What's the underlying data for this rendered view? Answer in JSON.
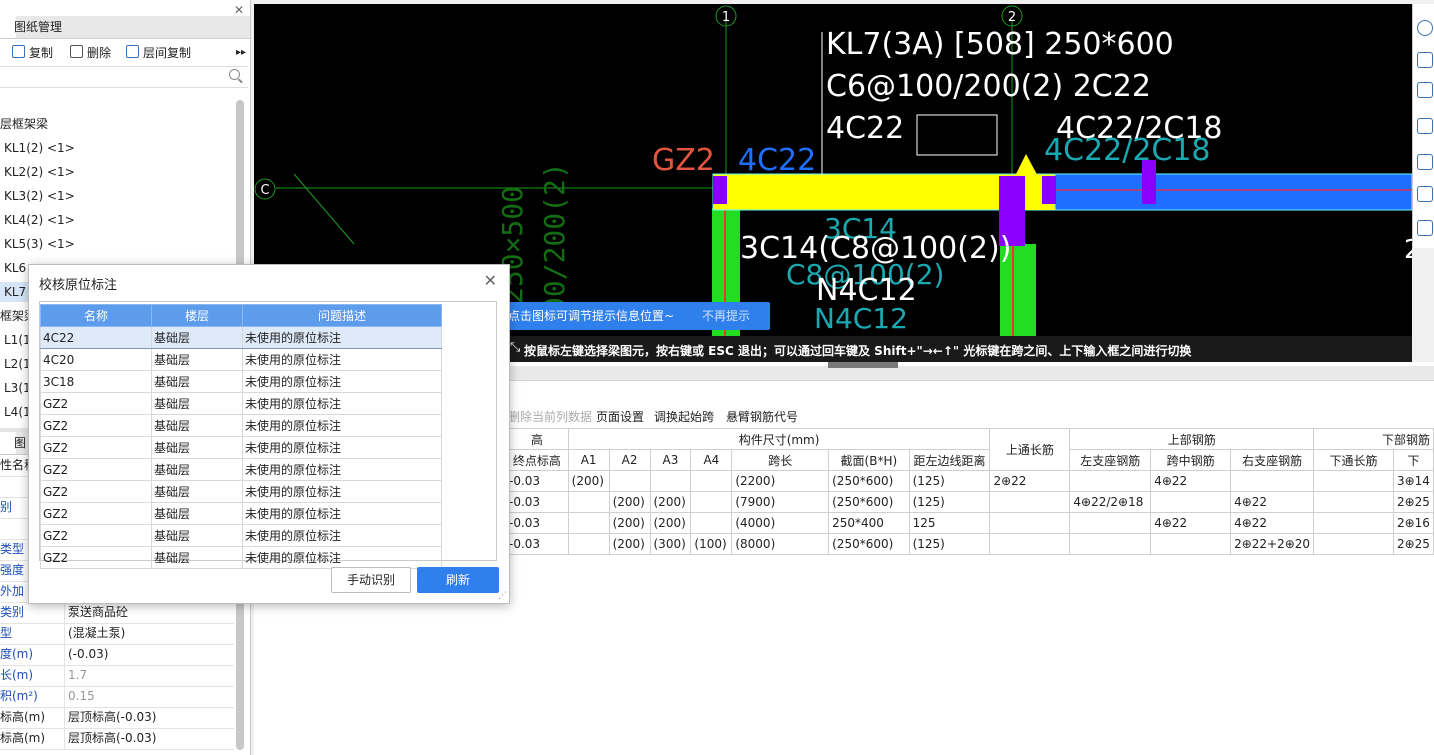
{
  "left_panel": {
    "tabs": [
      "",
      "图纸管理"
    ],
    "toolbar": {
      "copy": "复制",
      "delete": "删除",
      "floor_copy": "层间复制"
    },
    "tree": {
      "group1": "层框架梁",
      "items": [
        "KL1(2) <1>",
        "KL2(2) <1>",
        "KL3(2) <1>",
        "KL4(2) <1>",
        "KL5(3) <1>",
        "KL6",
        "KL7"
      ],
      "group2": "框架梁",
      "items2": [
        "L1(1",
        "L2(1",
        "L3(1",
        "L4(1"
      ]
    },
    "props_tabs": [
      "",
      "图"
    ],
    "props": [
      {
        "k": "性名称",
        "v": ""
      },
      {
        "k": "",
        "v": ""
      },
      {
        "k": "别",
        "v": ""
      },
      {
        "k": "",
        "v": ""
      },
      {
        "k": "类型",
        "v": ""
      },
      {
        "k": "强度",
        "v": ""
      },
      {
        "k": "外加",
        "v": ""
      },
      {
        "k": "类别",
        "v": "泵送商品砼"
      },
      {
        "k": "型",
        "v": "(混凝土泵)"
      },
      {
        "k": "度(m)",
        "v": "(-0.03)"
      },
      {
        "k": "长(m)",
        "v": "1.7"
      },
      {
        "k": "积(m²)",
        "v": "0.15"
      },
      {
        "k": "标高(m)",
        "v": "层顶标高(-0.03)"
      },
      {
        "k": "标高(m)",
        "v": "层顶标高(-0.03)"
      }
    ]
  },
  "cad": {
    "axis1": "1",
    "axis2": "2",
    "axisC": "C",
    "text_kl7": "KL7(3A) [508] 250*600",
    "text_stirrup": "C6@100/200(2) 2C22",
    "text_4c22": "4C22",
    "text_4c22_2c18": "4C22/2C18",
    "text_gz2": "GZ2",
    "text_4c22_cyan": "4C22",
    "text_3c14": "3C14(C8@100(2))",
    "text_n4c12": "N4C12",
    "text_cyan_3c14": "3C14",
    "text_cyan_c8": "C8@100(2)",
    "text_cyan_n4c12": "N4C12",
    "text_cyan_4c22_2c18": "4C22/2C18",
    "text_green_250": "250×500",
    "text_green_200": "00/200(2)",
    "text_right_2": "2",
    "tip_text": "点击图标可调节提示信息位置~",
    "tip_dismiss": "不再提示",
    "status_text": "按鼠标左键选择梁图元，按右键或 ESC 退出；可以通过回车键及 Shift+\"→←↑\" 光标键在跨之间、上下输入框之间进行切换"
  },
  "grid_toolbar": [
    "删除当前列数据",
    "页面设置",
    "调换起始跨",
    "悬臂钢筋代号"
  ],
  "grid": {
    "h_top": [
      "高",
      "构件尺寸(mm)",
      "上通长筋",
      "上部钢筋",
      "下部钢筋"
    ],
    "h_sub": [
      "终点标高",
      "A1",
      "A2",
      "A3",
      "A4",
      "跨长",
      "截面(B*H)",
      "距左边线距离",
      "左支座钢筋",
      "跨中钢筋",
      "右支座钢筋",
      "下通长筋",
      "下"
    ],
    "rows": [
      [
        "-0.03",
        "(200)",
        "",
        "",
        "",
        "(2200)",
        "(250*600)",
        "(125)",
        "2⊕22",
        "",
        "4⊕22",
        "",
        "",
        "3⊕14"
      ],
      [
        "-0.03",
        "",
        "(200)",
        "(200)",
        "",
        "(7900)",
        "(250*600)",
        "(125)",
        "",
        "4⊕22/2⊕18",
        "",
        "4⊕22",
        "",
        "2⊕25"
      ],
      [
        "-0.03",
        "",
        "(200)",
        "(200)",
        "",
        "(4000)",
        "250*400",
        "125",
        "",
        "",
        "4⊕22",
        "4⊕22",
        "",
        "2⊕16"
      ],
      [
        "-0.03",
        "",
        "(200)",
        "(300)",
        "(100)",
        "(8000)",
        "(250*600)",
        "(125)",
        "",
        "",
        "",
        "2⊕22+2⊕20",
        "",
        "2⊕25"
      ]
    ]
  },
  "dialog": {
    "title": "校核原位标注",
    "columns": [
      "名称",
      "楼层",
      "问题描述"
    ],
    "rows": [
      [
        "4C22",
        "基础层",
        "未使用的原位标注"
      ],
      [
        "4C20",
        "基础层",
        "未使用的原位标注"
      ],
      [
        "3C18",
        "基础层",
        "未使用的原位标注"
      ],
      [
        "GZ2",
        "基础层",
        "未使用的原位标注"
      ],
      [
        "GZ2",
        "基础层",
        "未使用的原位标注"
      ],
      [
        "GZ2",
        "基础层",
        "未使用的原位标注"
      ],
      [
        "GZ2",
        "基础层",
        "未使用的原位标注"
      ],
      [
        "GZ2",
        "基础层",
        "未使用的原位标注"
      ],
      [
        "GZ2",
        "基础层",
        "未使用的原位标注"
      ],
      [
        "GZ2",
        "基础层",
        "未使用的原位标注"
      ],
      [
        "GZ2",
        "基础层",
        "未使用的原位标注"
      ]
    ],
    "btn_manual": "手动识别",
    "btn_refresh": "刷新"
  },
  "colors": {
    "accent": "#2f80ed",
    "beam_yellow": "#ffff00",
    "beam_blue": "#1e6fff",
    "column_green": "#22dd22",
    "purple": "#8a00ff",
    "cyan_text": "#1aa9b0"
  }
}
